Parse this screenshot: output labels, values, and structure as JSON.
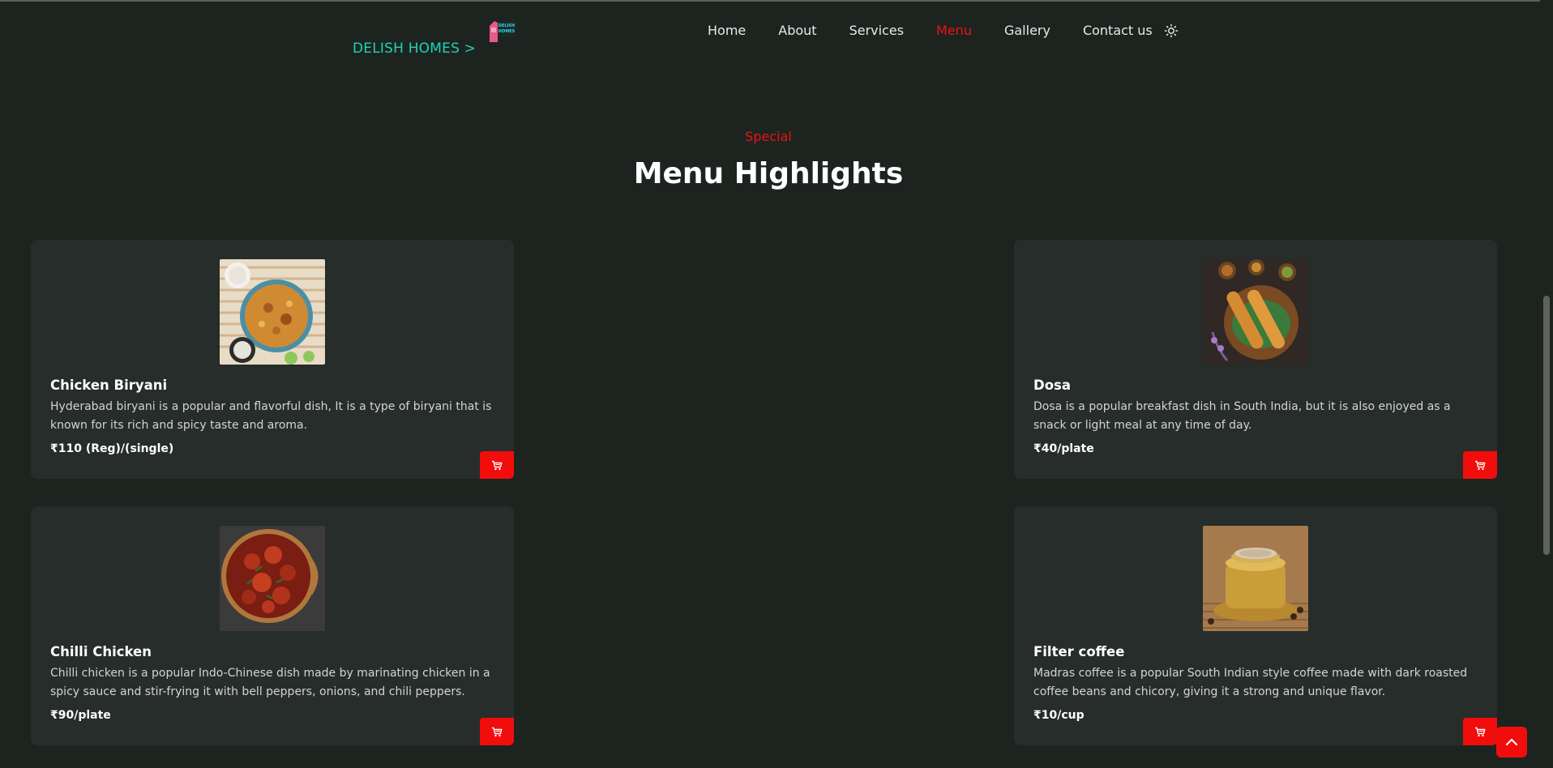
{
  "header": {
    "brand": "DELISH HOMES >",
    "logo_text": "DELISH HOMES",
    "nav": [
      "Home",
      "About",
      "Services",
      "Menu",
      "Gallery",
      "Contact us"
    ],
    "active_nav": "Menu"
  },
  "section": {
    "eyebrow": "Special",
    "title": "Menu Highlights"
  },
  "menu": [
    {
      "name": "Chicken Biryani",
      "description": "Hyderabad biryani is a popular and flavorful dish, It is a type of biryani that is known for its rich and spicy taste and aroma.",
      "price": "₹110 (Reg)/(single)"
    },
    {
      "name": "Dosa",
      "description": "Dosa is a popular breakfast dish in South India, but it is also enjoyed as a snack or light meal at any time of day.",
      "price": "₹40/plate"
    },
    {
      "name": "Chilli Chicken",
      "description": "Chilli chicken is a popular Indo-Chinese dish made by marinating chicken in a spicy sauce and stir-frying it with bell peppers, onions, and chili peppers.",
      "price": "₹90/plate"
    },
    {
      "name": "Filter coffee",
      "description": "Madras coffee is a popular South Indian style coffee made with dark roasted coffee beans and chicory, giving it a strong and unique flavor.",
      "price": "₹10/cup"
    }
  ],
  "icons": {
    "theme": "sun-icon",
    "cart": "cart-icon",
    "scroll_top": "chevron-up-icon"
  },
  "colors": {
    "accent": "#f20d0d",
    "brand": "#1fd1b6",
    "background": "#1d2420",
    "card": "#262d2a"
  }
}
